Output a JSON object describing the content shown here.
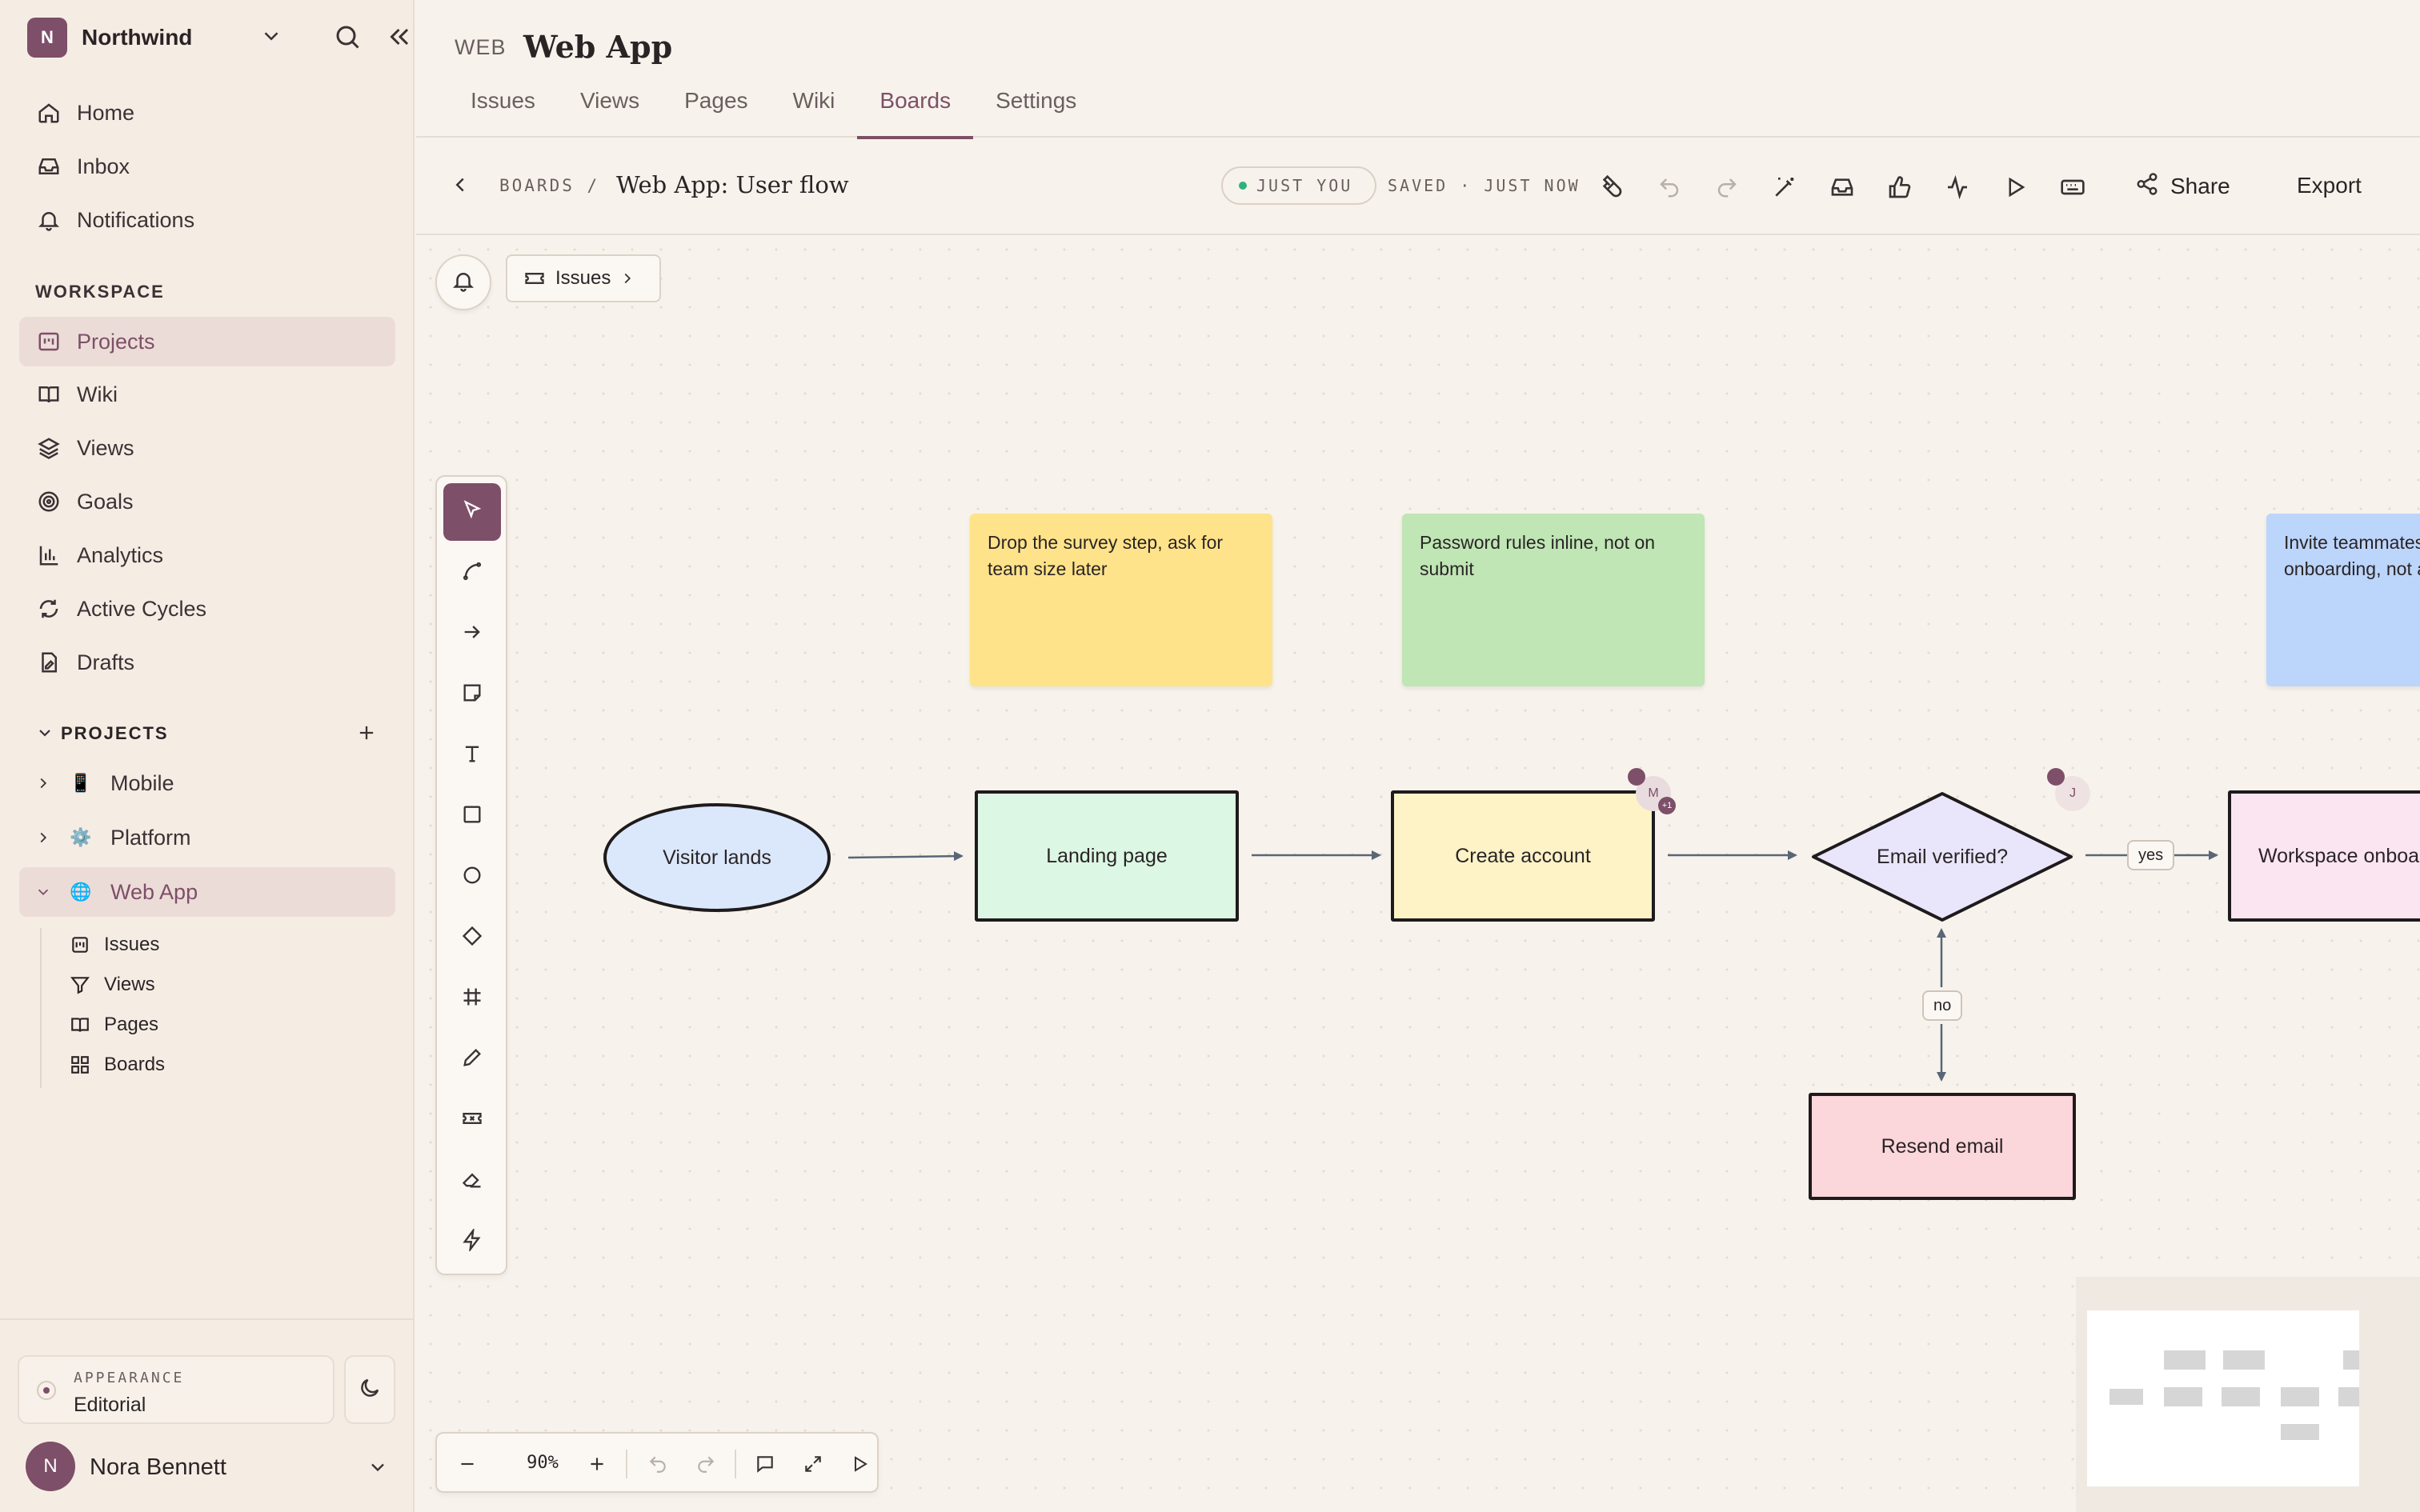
{
  "sidebar": {
    "workspace": {
      "initial": "N",
      "name": "Northwind"
    },
    "nav": [
      {
        "label": "Home",
        "icon": "home-icon"
      },
      {
        "label": "Inbox",
        "icon": "inbox-icon"
      },
      {
        "label": "Notifications",
        "icon": "bell-icon"
      }
    ],
    "workspace_section": {
      "title": "WORKSPACE",
      "items": [
        {
          "label": "Projects",
          "icon": "projects-icon",
          "active": true
        },
        {
          "label": "Wiki",
          "icon": "book-icon"
        },
        {
          "label": "Views",
          "icon": "layers-icon"
        },
        {
          "label": "Goals",
          "icon": "target-icon"
        },
        {
          "label": "Analytics",
          "icon": "bar-chart-icon"
        },
        {
          "label": "Active Cycles",
          "icon": "cycle-icon"
        },
        {
          "label": "Drafts",
          "icon": "draft-icon"
        }
      ]
    },
    "projects_section": {
      "title": "PROJECTS",
      "items": [
        {
          "label": "Mobile",
          "emoji": "📱"
        },
        {
          "label": "Platform",
          "emoji": "⚙️"
        },
        {
          "label": "Web App",
          "emoji": "🌐",
          "active": true
        }
      ],
      "web_app_children": [
        {
          "label": "Issues",
          "icon": "issues-icon"
        },
        {
          "label": "Views",
          "icon": "filter-icon"
        },
        {
          "label": "Pages",
          "icon": "book-icon"
        },
        {
          "label": "Boards",
          "icon": "grid-icon"
        }
      ]
    },
    "appearance": {
      "label": "APPEARANCE",
      "value": "Editorial"
    },
    "user": {
      "initial": "N",
      "name": "Nora Bennett"
    }
  },
  "header": {
    "project_code": "WEB",
    "project_title": "Web App",
    "tabs": [
      "Issues",
      "Views",
      "Pages",
      "Wiki",
      "Boards",
      "Settings"
    ],
    "active_tab": "Boards"
  },
  "board_bar": {
    "crumb": "BOARDS /",
    "title": "Web App: User flow",
    "presence": "JUST YOU",
    "saved": "SAVED · JUST NOW",
    "share_label": "Share",
    "export_label": "Export"
  },
  "canvas": {
    "issues_chip": "Issues",
    "zoom": "90%",
    "stickies": [
      {
        "text": "Drop the survey step, ask for team size later",
        "color": "#ffe38a"
      },
      {
        "text": "Password rules inline, not on submit",
        "color": "#bfe6b4"
      },
      {
        "text": "Invite teammates during onboarding, not after",
        "color": "#bcd5fb"
      }
    ],
    "nodes": {
      "visitor": "Visitor lands",
      "landing": "Landing page",
      "create": "Create account",
      "verified": "Email verified?",
      "workspace": "Workspace onboarding",
      "resend": "Resend email"
    },
    "edge_labels": {
      "yes": "yes",
      "no": "no"
    },
    "cursors": [
      {
        "initial": "M",
        "badge": "+1"
      },
      {
        "initial": "J"
      }
    ],
    "colors": {
      "accent": "#7d4f68",
      "visitor_fill": "#dbe8fb",
      "landing_fill": "#dcf7e3",
      "create_fill": "#fdf3c7",
      "verified_fill": "#e9e6fb",
      "workspace_fill": "#fbe5f1",
      "resend_fill": "#fbd6da"
    }
  }
}
